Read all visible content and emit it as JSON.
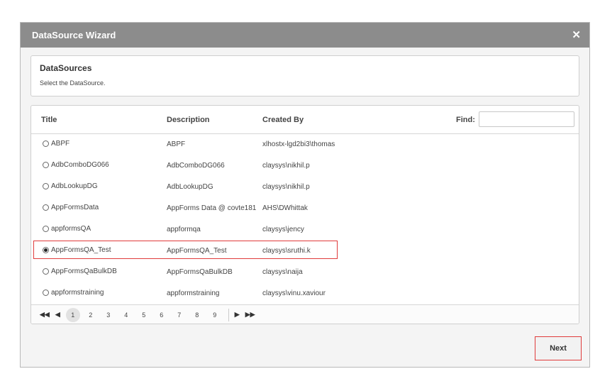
{
  "dialog": {
    "title": "DataSource Wizard",
    "close_icon": "close-icon"
  },
  "datasources_panel": {
    "heading": "DataSources",
    "subtitle": "Select the DataSource."
  },
  "grid": {
    "columns": {
      "title": "Title",
      "description": "Description",
      "created_by": "Created By"
    },
    "find_label": "Find:",
    "find_value": "",
    "rows": [
      {
        "title": "ABPF",
        "description": "ABPF",
        "created_by": "xlhostx-lgd2bi3\\thomas",
        "selected": false
      },
      {
        "title": "AdbComboDG066",
        "description": "AdbComboDG066",
        "created_by": "claysys\\nikhil.p",
        "selected": false
      },
      {
        "title": "AdbLookupDG",
        "description": "AdbLookupDG",
        "created_by": "claysys\\nikhil.p",
        "selected": false
      },
      {
        "title": "AppFormsData",
        "description": "AppForms Data @ covte181",
        "created_by": "AHS\\DWhittak",
        "selected": false
      },
      {
        "title": "appformsQA",
        "description": "appformqa",
        "created_by": "claysys\\jency",
        "selected": false
      },
      {
        "title": "AppFormsQA_Test",
        "description": "AppFormsQA_Test",
        "created_by": "claysys\\sruthi.k",
        "selected": true
      },
      {
        "title": "AppFormsQaBulkDB",
        "description": "AppFormsQaBulkDB",
        "created_by": "claysys\\naija",
        "selected": false
      },
      {
        "title": "appformstraining",
        "description": "appformstraining",
        "created_by": "claysys\\vinu.xaviour",
        "selected": false
      }
    ]
  },
  "pager": {
    "first": "◀◀",
    "prev": "◀",
    "pages": [
      "1",
      "2",
      "3",
      "4",
      "5",
      "6",
      "7",
      "8",
      "9"
    ],
    "current_page": "1",
    "next": "▶",
    "last": "▶▶"
  },
  "footer": {
    "next_label": "Next"
  },
  "colors": {
    "titlebar": "#8c8c8c",
    "highlight": "#e03b3b"
  }
}
